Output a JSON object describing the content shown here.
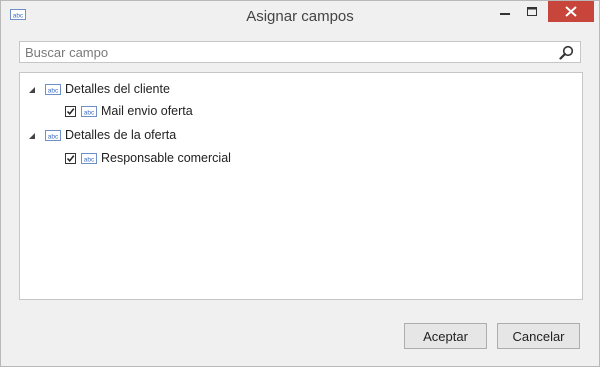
{
  "window": {
    "title": "Asignar campos",
    "app_icon": "abc-field-icon",
    "controls": [
      "minimize-icon",
      "maximize-icon",
      "close-icon"
    ],
    "close_color": "#c7453a"
  },
  "search": {
    "placeholder": "Buscar campo",
    "value": "",
    "icon": "search-icon"
  },
  "tree": {
    "groups": [
      {
        "label": "Detalles del cliente",
        "expanded": true,
        "children": [
          {
            "label": "Mail envio oferta",
            "checked": true
          }
        ]
      },
      {
        "label": "Detalles de la oferta",
        "expanded": true,
        "children": [
          {
            "label": "Responsable comercial",
            "checked": true
          }
        ]
      }
    ]
  },
  "buttons": {
    "ok": "Aceptar",
    "cancel": "Cancelar"
  }
}
